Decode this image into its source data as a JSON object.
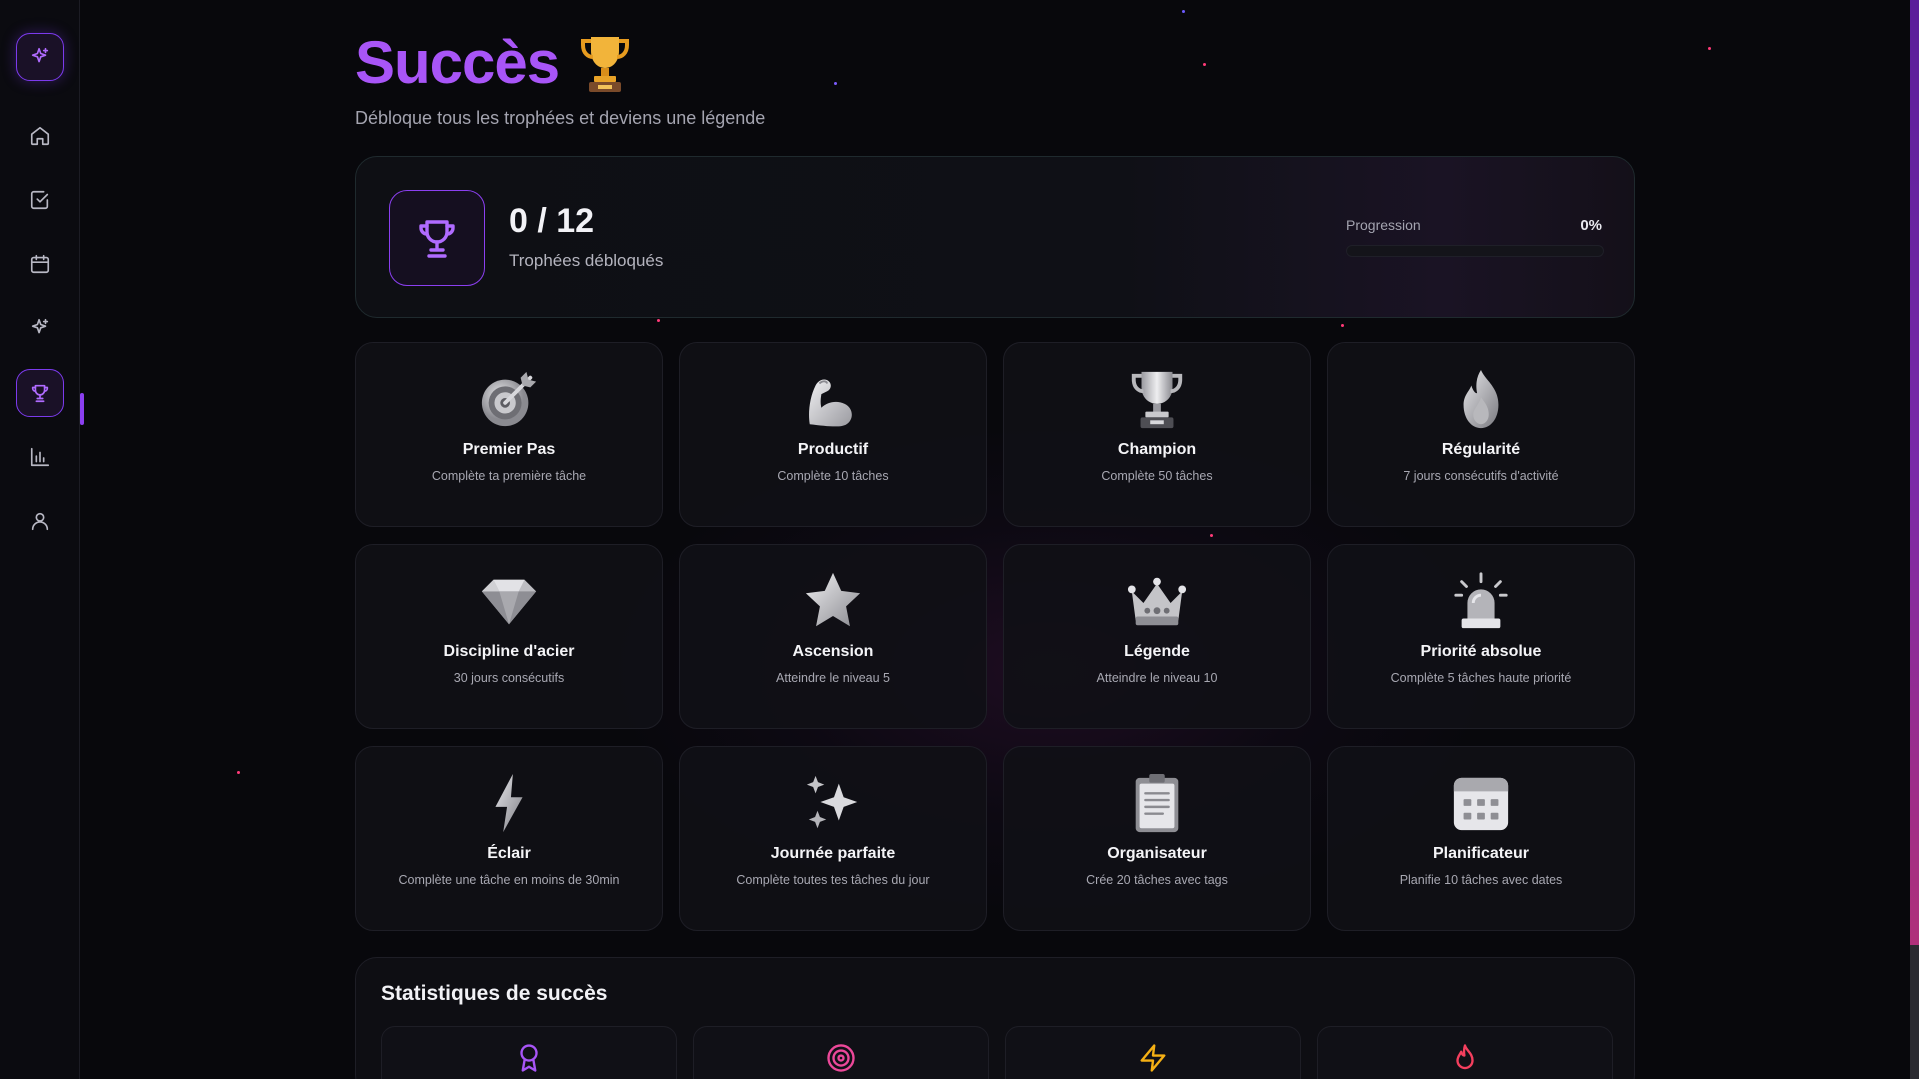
{
  "header": {
    "title": "Succès",
    "subtitle": "Débloque tous les trophées et deviens une légende"
  },
  "summary": {
    "count": "0 / 12",
    "label": "Trophées débloqués",
    "progress_label": "Progression",
    "progress_value": "0%",
    "progress_fraction": 0
  },
  "sidebar": {
    "items": [
      {
        "name": "home",
        "icon": "home-icon"
      },
      {
        "name": "tasks",
        "icon": "check-square-icon"
      },
      {
        "name": "calendar",
        "icon": "calendar-icon"
      },
      {
        "name": "ai",
        "icon": "sparkles-icon"
      },
      {
        "name": "achievements",
        "icon": "trophy-icon",
        "active": true
      },
      {
        "name": "stats",
        "icon": "bar-chart-icon"
      },
      {
        "name": "profile",
        "icon": "user-icon"
      }
    ]
  },
  "achievements": [
    {
      "title": "Premier Pas",
      "desc": "Complète ta première tâche",
      "icon": "target-icon"
    },
    {
      "title": "Productif",
      "desc": "Complète 10 tâches",
      "icon": "muscle-icon"
    },
    {
      "title": "Champion",
      "desc": "Complète 50 tâches",
      "icon": "trophy-icon"
    },
    {
      "title": "Régularité",
      "desc": "7 jours consécutifs d'activité",
      "icon": "flame-icon"
    },
    {
      "title": "Discipline d'acier",
      "desc": "30 jours consécutifs",
      "icon": "diamond-icon"
    },
    {
      "title": "Ascension",
      "desc": "Atteindre le niveau 5",
      "icon": "star-icon"
    },
    {
      "title": "Légende",
      "desc": "Atteindre le niveau 10",
      "icon": "crown-icon"
    },
    {
      "title": "Priorité absolue",
      "desc": "Complète 5 tâches haute priorité",
      "icon": "siren-icon"
    },
    {
      "title": "Éclair",
      "desc": "Complète une tâche en moins de 30min",
      "icon": "lightning-icon"
    },
    {
      "title": "Journée parfaite",
      "desc": "Complète toutes tes tâches du jour",
      "icon": "sparkles-icon"
    },
    {
      "title": "Organisateur",
      "desc": "Crée 20 tâches avec tags",
      "icon": "clipboard-icon"
    },
    {
      "title": "Planificateur",
      "desc": "Planifie 10 tâches avec dates",
      "icon": "calendar-icon"
    }
  ],
  "stats": {
    "title": "Statistiques de succès",
    "icons": [
      {
        "icon": "award-icon",
        "color": "#a855f7"
      },
      {
        "icon": "target-icon",
        "color": "#ec4899"
      },
      {
        "icon": "zap-icon",
        "color": "#f5b014"
      },
      {
        "icon": "flame-icon",
        "color": "#f43f5e"
      }
    ]
  },
  "colors": {
    "accent": "#a855f7",
    "accent_border": "#8b3ff0",
    "background": "#08080c"
  }
}
